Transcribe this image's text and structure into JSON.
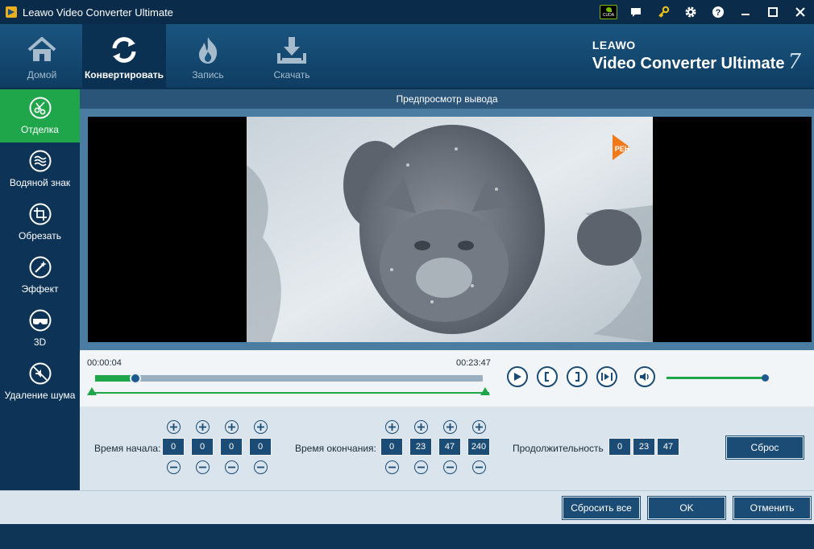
{
  "window": {
    "title": "Leawo Video Converter Ultimate",
    "controls": [
      "cuda-icon",
      "chat-icon",
      "key-icon",
      "gear-icon",
      "help-icon",
      "minimize-icon",
      "maximize-icon",
      "close-icon"
    ],
    "cuda_label": "CUDA"
  },
  "nav": {
    "tabs": [
      {
        "label": "Домой",
        "icon": "home-icon"
      },
      {
        "label": "Конвертировать",
        "icon": "convert-icon",
        "active": true
      },
      {
        "label": "Запись",
        "icon": "burn-icon"
      },
      {
        "label": "Скачать",
        "icon": "download-icon"
      }
    ],
    "brand_line1": "LEAWO",
    "brand_line2": "Video Converter Ultimate",
    "brand_version": "7"
  },
  "sidebar": {
    "items": [
      {
        "label": "Отделка",
        "icon": "scissors-icon",
        "active": true
      },
      {
        "label": "Водяной знак",
        "icon": "watermark-icon"
      },
      {
        "label": "Обрезать",
        "icon": "crop-icon"
      },
      {
        "label": "Эффект",
        "icon": "effect-wand-icon"
      },
      {
        "label": "3D",
        "icon": "3d-glasses-icon"
      },
      {
        "label": "Удаление шума",
        "icon": "noise-removal-icon"
      }
    ]
  },
  "preview": {
    "header": "Предпросмотр вывода",
    "watermark_text": "РЕН"
  },
  "timeline": {
    "current_time": "00:00:04",
    "total_time": "00:23:47",
    "progress_fraction": 0.104,
    "volume_fraction": 0.95
  },
  "trim": {
    "start_label": "Время начала:",
    "start_values": [
      "0",
      "0",
      "0",
      "0"
    ],
    "end_label": "Время окончания:",
    "end_values": [
      "0",
      "23",
      "47",
      "240"
    ],
    "duration_label": "Продолжительность",
    "duration_values": [
      "0",
      "23",
      "47"
    ],
    "reset_label": "Сброс"
  },
  "footer": {
    "reset_all_label": "Сбросить все",
    "ok_label": "OK",
    "cancel_label": "Отменить"
  },
  "colors": {
    "accent_green": "#1fa64b",
    "dark_blue": "#0e3556",
    "button_blue": "#1b4c75"
  }
}
